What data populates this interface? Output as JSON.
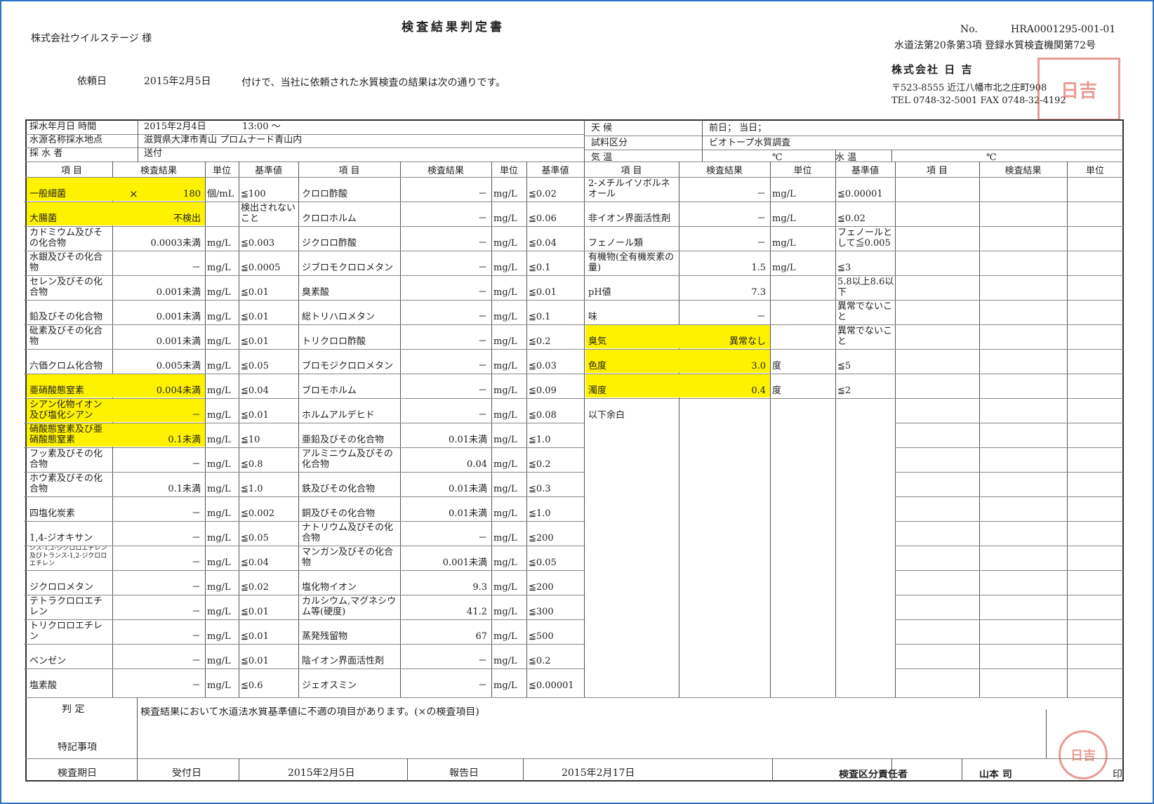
{
  "header": {
    "title": "検査結果判定書",
    "client": "株式会社ウイルステージ 様",
    "request_label": "依頼日",
    "request_date": "2015年2月5日",
    "request_text": "付けで、当社に依頼された水質検査の結果は次の通りです。",
    "no_label": "No.",
    "doc_no": "HRA0001295-001-01",
    "reg_text": "水道法第20条第3項 登録水質検査機関第72号",
    "company": "株式会社 日 吉",
    "address": "〒523-8555 近江八幡市北之庄町908",
    "tel": "TEL 0748-32-5001 FAX 0748-32-4192"
  },
  "sampling": {
    "date_label": "採水年月日 時間",
    "date": "2015年2月4日",
    "time": "13:00 ～",
    "place_label": "水源名称採水地点",
    "place": "滋賀県大津市青山 プロムナード青山内",
    "person_label": "採 水 者",
    "person": "送付",
    "weather_label": "天 候",
    "weather": "前日； 当日；",
    "sample_type_label": "試料区分",
    "sample_type": "ビオトープ水質調査",
    "air_temp_label": "気 温",
    "celsius": "℃",
    "water_temp_label": "水 温"
  },
  "table_headers": {
    "item": "項 目",
    "result": "検査結果",
    "unit": "単位",
    "standard": "基準値"
  },
  "col1": [
    {
      "name": "一般細菌",
      "mark": "×",
      "result": "180",
      "unit": "個/mL",
      "standard": "≦100",
      "hl": true
    },
    {
      "name": "大腸菌",
      "result": "不検出",
      "unit": "",
      "standard": "検出されないこと",
      "hl": true
    },
    {
      "name": "カドミウム及びその化合物",
      "result": "0.0003未満",
      "unit": "mg/L",
      "standard": "≦0.003"
    },
    {
      "name": "水銀及びその化合物",
      "result": "－",
      "unit": "mg/L",
      "standard": "≦0.0005"
    },
    {
      "name": "セレン及びその化合物",
      "result": "0.001未満",
      "unit": "mg/L",
      "standard": "≦0.01"
    },
    {
      "name": "鉛及びその化合物",
      "result": "0.001未満",
      "unit": "mg/L",
      "standard": "≦0.01"
    },
    {
      "name": "砒素及びその化合物",
      "result": "0.001未満",
      "unit": "mg/L",
      "standard": "≦0.01"
    },
    {
      "name": "六価クロム化合物",
      "result": "0.005未満",
      "unit": "mg/L",
      "standard": "≦0.05"
    },
    {
      "name": "亜硝酸態窒素",
      "result": "0.004未満",
      "unit": "mg/L",
      "standard": "≦0.04",
      "hl": true
    },
    {
      "name": "シアン化物イオン及び塩化シアン",
      "result": "－",
      "unit": "mg/L",
      "standard": "≦0.01",
      "hl": true
    },
    {
      "name": "硝酸態窒素及び亜硝酸態窒素",
      "result": "0.1未満",
      "unit": "mg/L",
      "standard": "≦10",
      "hl": true
    },
    {
      "name": "フッ素及びその化合物",
      "result": "－",
      "unit": "mg/L",
      "standard": "≦0.8"
    },
    {
      "name": "ホウ素及びその化合物",
      "result": "0.1未満",
      "unit": "mg/L",
      "standard": "≦1.0"
    },
    {
      "name": "四塩化炭素",
      "result": "－",
      "unit": "mg/L",
      "standard": "≦0.002"
    },
    {
      "name": "1,4-ジオキサン",
      "result": "－",
      "unit": "mg/L",
      "standard": "≦0.05"
    },
    {
      "name": "シス-1,2-ジクロロエチレン及びトランス-1,2-ジクロロエチレン",
      "result": "－",
      "unit": "mg/L",
      "standard": "≦0.04",
      "small": true
    },
    {
      "name": "ジクロロメタン",
      "result": "－",
      "unit": "mg/L",
      "standard": "≦0.02"
    },
    {
      "name": "テトラクロロエチレン",
      "result": "－",
      "unit": "mg/L",
      "standard": "≦0.01"
    },
    {
      "name": "トリクロロエチレン",
      "result": "－",
      "unit": "mg/L",
      "standard": "≦0.01"
    },
    {
      "name": "ベンゼン",
      "result": "－",
      "unit": "mg/L",
      "standard": "≦0.01"
    },
    {
      "name": "塩素酸",
      "result": "－",
      "unit": "mg/L",
      "standard": "≦0.6"
    }
  ],
  "col2": [
    {
      "name": "クロロ酢酸",
      "result": "－",
      "unit": "mg/L",
      "standard": "≦0.02"
    },
    {
      "name": "クロロホルム",
      "result": "－",
      "unit": "mg/L",
      "standard": "≦0.06"
    },
    {
      "name": "ジクロロ酢酸",
      "result": "－",
      "unit": "mg/L",
      "standard": "≦0.04"
    },
    {
      "name": "ジブロモクロロメタン",
      "result": "－",
      "unit": "mg/L",
      "standard": "≦0.1"
    },
    {
      "name": "臭素酸",
      "result": "－",
      "unit": "mg/L",
      "standard": "≦0.01"
    },
    {
      "name": "総トリハロメタン",
      "result": "－",
      "unit": "mg/L",
      "standard": "≦0.1"
    },
    {
      "name": "トリクロロ酢酸",
      "result": "－",
      "unit": "mg/L",
      "standard": "≦0.2"
    },
    {
      "name": "ブロモジクロロメタン",
      "result": "－",
      "unit": "mg/L",
      "standard": "≦0.03"
    },
    {
      "name": "ブロモホルム",
      "result": "－",
      "unit": "mg/L",
      "standard": "≦0.09"
    },
    {
      "name": "ホルムアルデヒド",
      "result": "－",
      "unit": "mg/L",
      "standard": "≦0.08"
    },
    {
      "name": "亜鉛及びその化合物",
      "result": "0.01未満",
      "unit": "mg/L",
      "standard": "≦1.0"
    },
    {
      "name": "アルミニウム及びその化合物",
      "result": "0.04",
      "unit": "mg/L",
      "standard": "≦0.2"
    },
    {
      "name": "鉄及びその化合物",
      "result": "0.01未満",
      "unit": "mg/L",
      "standard": "≦0.3"
    },
    {
      "name": "銅及びその化合物",
      "result": "0.01未満",
      "unit": "mg/L",
      "standard": "≦1.0"
    },
    {
      "name": "ナトリウム及びその化合物",
      "result": "－",
      "unit": "mg/L",
      "standard": "≦200"
    },
    {
      "name": "マンガン及びその化合物",
      "result": "0.001未満",
      "unit": "mg/L",
      "standard": "≦0.05"
    },
    {
      "name": "塩化物イオン",
      "result": "9.3",
      "unit": "mg/L",
      "standard": "≦200"
    },
    {
      "name": "カルシウム,マグネシウム等(硬度)",
      "result": "41.2",
      "unit": "mg/L",
      "standard": "≦300"
    },
    {
      "name": "蒸発残留物",
      "result": "67",
      "unit": "mg/L",
      "standard": "≦500"
    },
    {
      "name": "陰イオン界面活性剤",
      "result": "－",
      "unit": "mg/L",
      "standard": "≦0.2"
    },
    {
      "name": "ジェオスミン",
      "result": "－",
      "unit": "mg/L",
      "standard": "≦0.00001"
    }
  ],
  "col3": [
    {
      "name": "2-メチルイソボルネオール",
      "result": "－",
      "unit": "mg/L",
      "standard": "≦0.00001"
    },
    {
      "name": "非イオン界面活性剤",
      "result": "－",
      "unit": "mg/L",
      "standard": "≦0.02"
    },
    {
      "name": "フェノール類",
      "result": "－",
      "unit": "mg/L",
      "standard": "フェノールとして≦0.005"
    },
    {
      "name": "有機物(全有機炭素の量)",
      "result": "1.5",
      "unit": "mg/L",
      "standard": "≦3"
    },
    {
      "name": "pH値",
      "result": "7.3",
      "unit": "",
      "standard": "5.8以上8.6以下"
    },
    {
      "name": "味",
      "result": "－",
      "unit": "",
      "standard": "異常でないこと"
    },
    {
      "name": "臭気",
      "result": "異常なし",
      "unit": "",
      "standard": "異常でないこと",
      "hl": true
    },
    {
      "name": "色度",
      "result": "3.0",
      "unit": "度",
      "standard": "≦5",
      "hl": true
    },
    {
      "name": "濁度",
      "result": "0.4",
      "unit": "度",
      "standard": "≦2",
      "hl": true
    },
    {
      "name": "以下余白",
      "result": "",
      "unit": "",
      "standard": ""
    }
  ],
  "footer": {
    "judgement_label": "判 定",
    "judgement": "検査結果において水道法水質基準値に不適の項目があります。(×の検査項目)",
    "notes_label": "特記事項",
    "period_label": "検査期日",
    "received_label": "受付日",
    "received_date": "2015年2月5日",
    "report_label": "報告日",
    "report_date": "2015年2月17日",
    "manager_label": "検査区分責任者",
    "manager": "山本 司",
    "seal_mark": "印"
  },
  "seal_text": "日吉",
  "colors": {
    "frame": "#2a73c6",
    "highlight": "#fff200",
    "seal": "#d84a3a"
  }
}
